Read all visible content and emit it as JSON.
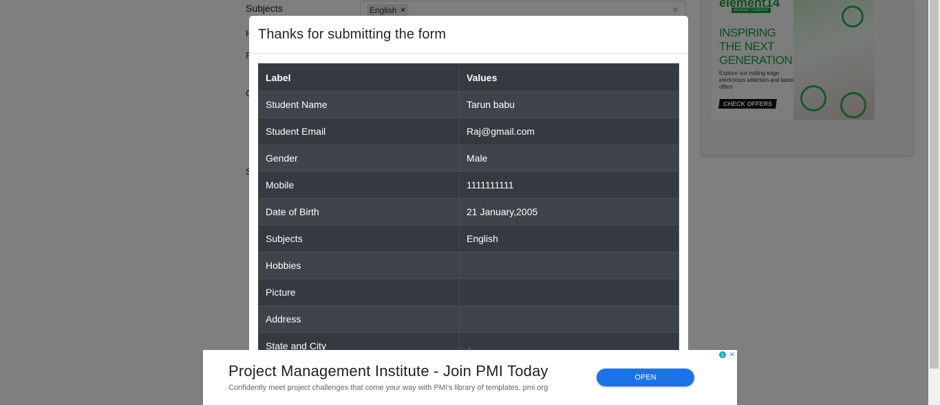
{
  "background_form": {
    "subjects_label": "Subjects",
    "subjects_chip": "English",
    "side_letters": [
      "H",
      "P",
      "C",
      "S"
    ]
  },
  "side_ad": {
    "brand": "element14",
    "brand_sub": "AN AVNET COMPANY",
    "headline": "INSPIRING THE NEXT GENERATION",
    "body": "Explore our cutting-edge electronics selection and latest offers",
    "cta": "CHECK OFFERS"
  },
  "modal": {
    "title": "Thanks for submitting the form",
    "headers": [
      "Label",
      "Values"
    ],
    "rows": [
      {
        "label": "Student Name",
        "value": "Tarun babu"
      },
      {
        "label": "Student Email",
        "value": "Raj@gmail.com"
      },
      {
        "label": "Gender",
        "value": "Male"
      },
      {
        "label": "Mobile",
        "value": "1111111111"
      },
      {
        "label": "Date of Birth",
        "value": "21 January,2005"
      },
      {
        "label": "Subjects",
        "value": "English"
      },
      {
        "label": "Hobbies",
        "value": ""
      },
      {
        "label": "Picture",
        "value": ""
      },
      {
        "label": "Address",
        "value": ""
      },
      {
        "label": "State and City",
        "value": ""
      }
    ]
  },
  "bottom_ad": {
    "title": "Project Management Institute - Join PMI Today",
    "description": "Confidently meet project challenges that come your way with PMI's library of templates. pmi.org",
    "button": "OPEN"
  },
  "colors": {
    "table_dark": "#343a40",
    "table_stripe": "#3e444a",
    "brand_green": "#1a9b3c",
    "ad_button": "#1a73e8"
  }
}
